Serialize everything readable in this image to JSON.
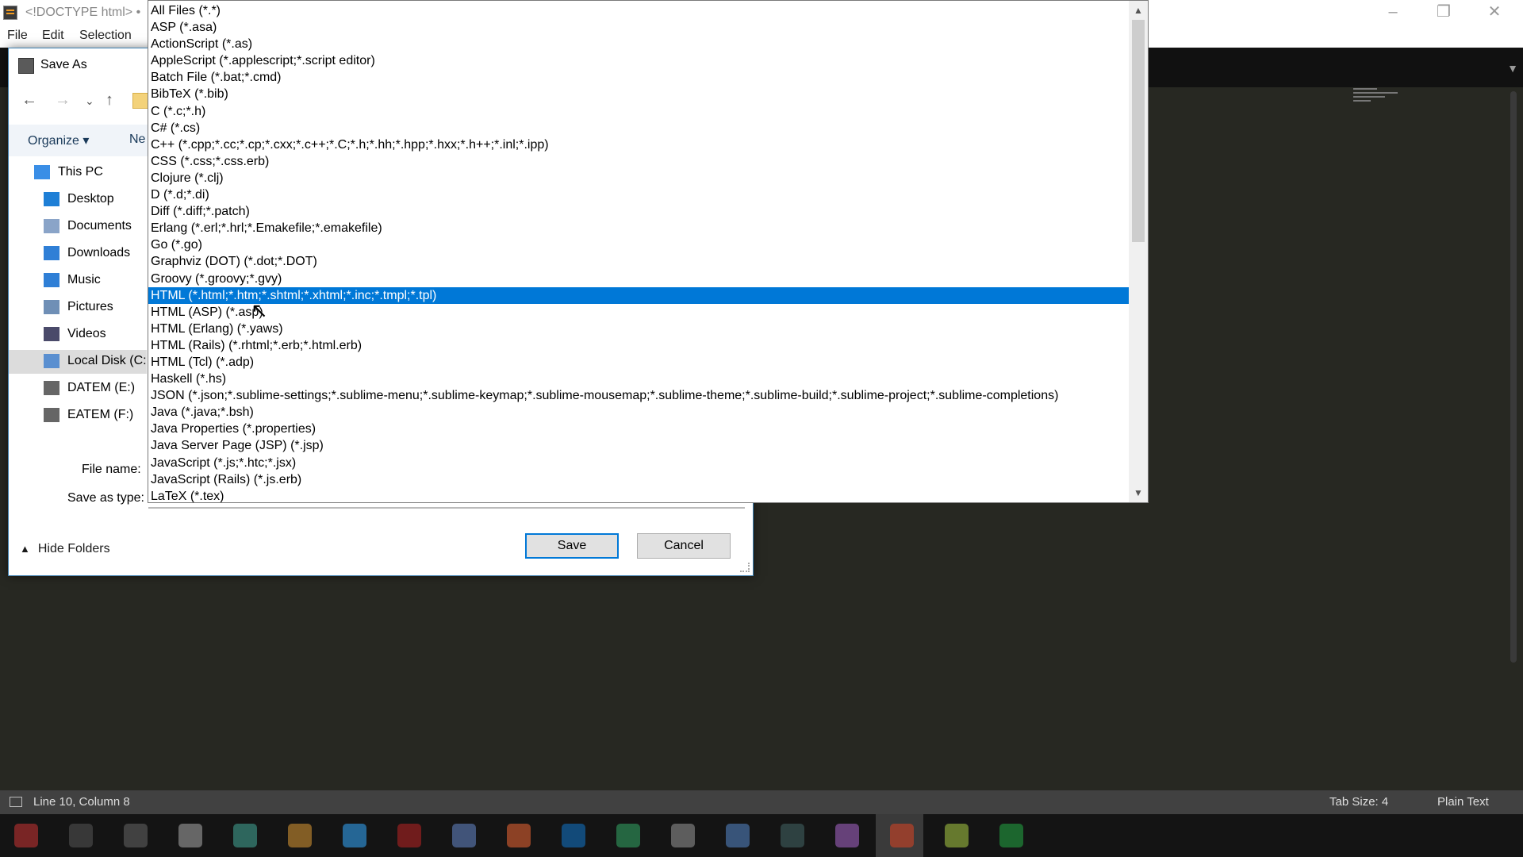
{
  "editor": {
    "title": "<!DOCTYPE html> •",
    "menu": [
      "File",
      "Edit",
      "Selection"
    ],
    "window_buttons": {
      "minimize": "–",
      "restore": "❐",
      "close": "✕"
    },
    "tab_dropdown_icon": "▼"
  },
  "dialog": {
    "title": "Save As",
    "nav_buttons": {
      "back": "←",
      "forward": "→",
      "recent": "⌄",
      "up": "↑"
    },
    "organize_label": "Organize ▾",
    "new_folder_label": "Ne",
    "nav_items": [
      {
        "label": "This PC",
        "icon": "computer-icon",
        "color": "#3a8ee6"
      },
      {
        "label": "Desktop",
        "icon": "desktop-icon",
        "color": "#1e7fd6"
      },
      {
        "label": "Documents",
        "icon": "documents-icon",
        "color": "#8aa4c8"
      },
      {
        "label": "Downloads",
        "icon": "downloads-icon",
        "color": "#2f7fd6"
      },
      {
        "label": "Music",
        "icon": "music-icon",
        "color": "#2f7fd6"
      },
      {
        "label": "Pictures",
        "icon": "pictures-icon",
        "color": "#6f8fb6"
      },
      {
        "label": "Videos",
        "icon": "videos-icon",
        "color": "#4a4a6a"
      },
      {
        "label": "Local Disk (C:",
        "icon": "drive-icon",
        "color": "#5a8fd0"
      },
      {
        "label": "DATEM (E:)",
        "icon": "drive-icon",
        "color": "#666666"
      },
      {
        "label": "EATEM (F:)",
        "icon": "drive-icon",
        "color": "#666666"
      }
    ],
    "file_name_label": "File name:",
    "save_as_type_label": "Save as type:",
    "hide_folders_label": "Hide Folders",
    "save_label": "Save",
    "cancel_label": "Cancel",
    "file_types": [
      "All Files (*.*)",
      "ASP (*.asa)",
      "ActionScript (*.as)",
      "AppleScript (*.applescript;*.script editor)",
      "Batch File (*.bat;*.cmd)",
      "BibTeX (*.bib)",
      "C (*.c;*.h)",
      "C# (*.cs)",
      "C++ (*.cpp;*.cc;*.cp;*.cxx;*.c++;*.C;*.h;*.hh;*.hpp;*.hxx;*.h++;*.inl;*.ipp)",
      "CSS (*.css;*.css.erb)",
      "Clojure (*.clj)",
      "D (*.d;*.di)",
      "Diff (*.diff;*.patch)",
      "Erlang (*.erl;*.hrl;*.Emakefile;*.emakefile)",
      "Go (*.go)",
      "Graphviz (DOT) (*.dot;*.DOT)",
      "Groovy (*.groovy;*.gvy)",
      "HTML (*.html;*.htm;*.shtml;*.xhtml;*.inc;*.tmpl;*.tpl)",
      "HTML (ASP) (*.asp)",
      "HTML (Erlang) (*.yaws)",
      "HTML (Rails) (*.rhtml;*.erb;*.html.erb)",
      "HTML (Tcl) (*.adp)",
      "Haskell (*.hs)",
      "JSON (*.json;*.sublime-settings;*.sublime-menu;*.sublime-keymap;*.sublime-mousemap;*.sublime-theme;*.sublime-build;*.sublime-project;*.sublime-completions)",
      "Java (*.java;*.bsh)",
      "Java Properties (*.properties)",
      "Java Server Page (JSP) (*.jsp)",
      "JavaScript (*.js;*.htc;*.jsx)",
      "JavaScript (Rails) (*.js.erb)",
      "LaTeX (*.tex)"
    ],
    "selected_file_type_index": 17
  },
  "statusbar": {
    "position": "Line 10, Column 8",
    "tab_size": "Tab Size: 4",
    "syntax": "Plain Text"
  },
  "colors": {
    "accent": "#0078d7",
    "editor_bg": "#272822",
    "statusbar_bg": "#414141"
  }
}
